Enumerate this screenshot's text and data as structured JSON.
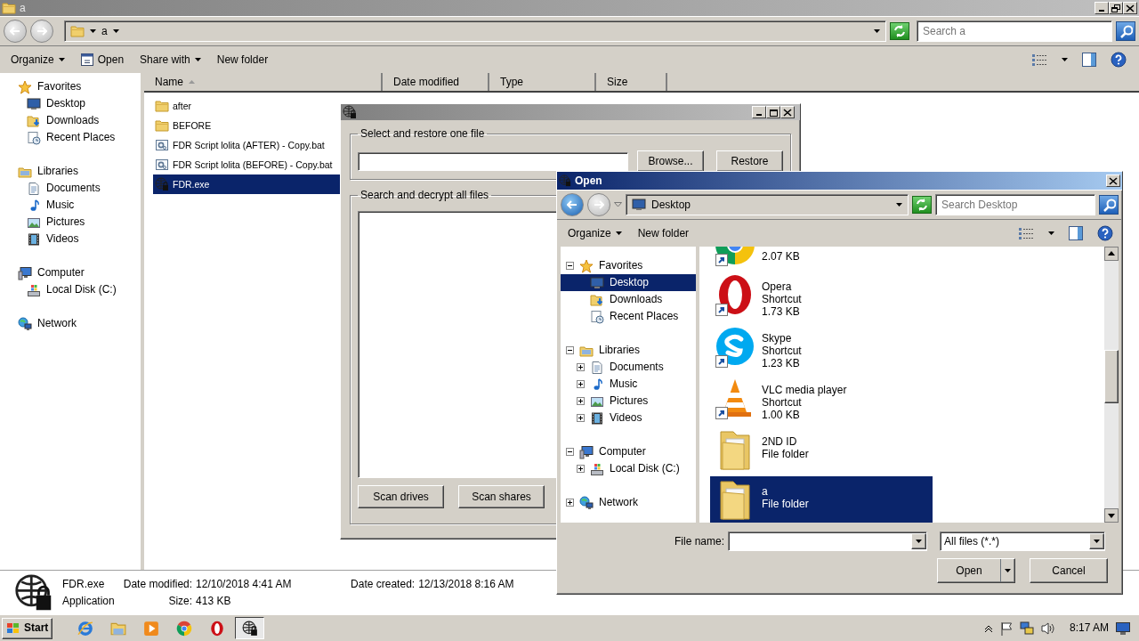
{
  "explorer": {
    "title": "a",
    "path": [
      "a"
    ],
    "search": {
      "placeholder": "Search a"
    },
    "toolbar": [
      {
        "label": "Organize",
        "kind": "menu"
      },
      {
        "label": "Open",
        "kind": "command"
      },
      {
        "label": "Share with",
        "kind": "menu"
      },
      {
        "label": "New folder",
        "kind": "plain"
      }
    ],
    "nav": [
      {
        "label": "Favorites",
        "kind": "favorites",
        "children": [
          {
            "label": "Desktop",
            "kind": "desktop"
          },
          {
            "label": "Downloads",
            "kind": "downloads"
          },
          {
            "label": "Recent Places",
            "kind": "recent"
          }
        ]
      },
      {
        "label": "Libraries",
        "kind": "libraries",
        "children": [
          {
            "label": "Documents",
            "kind": "documents"
          },
          {
            "label": "Music",
            "kind": "music"
          },
          {
            "label": "Pictures",
            "kind": "pictures"
          },
          {
            "label": "Videos",
            "kind": "videos"
          }
        ]
      },
      {
        "label": "Computer",
        "kind": "computer",
        "children": [
          {
            "label": "Local Disk (C:)",
            "kind": "disk"
          }
        ]
      },
      {
        "label": "Network",
        "kind": "network"
      }
    ],
    "columns": [
      {
        "label": "Name",
        "sorted": true
      },
      {
        "label": "Date modified",
        "sorted": false
      },
      {
        "label": "Type",
        "sorted": false
      },
      {
        "label": "Size",
        "sorted": false
      }
    ],
    "files": [
      {
        "name": "after",
        "kind": "folder",
        "selected": false
      },
      {
        "name": "BEFORE",
        "kind": "folder",
        "selected": false
      },
      {
        "name": "FDR Script lolita (AFTER) - Copy.bat",
        "kind": "script",
        "selected": false
      },
      {
        "name": "FDR Script lolita (BEFORE) - Copy.bat",
        "kind": "script",
        "selected": false
      },
      {
        "name": "FDR.exe",
        "kind": "app",
        "selected": true
      }
    ],
    "details": {
      "name": "FDR.exe",
      "type": "Application",
      "fields": [
        {
          "label": "Date modified:",
          "value": "12/10/2018 4:41 AM"
        },
        {
          "label": "Date created:",
          "value": "12/13/2018 8:16 AM"
        },
        {
          "label": "Size:",
          "value": "413 KB"
        }
      ]
    }
  },
  "fdr_window": {
    "restore_group": {
      "title": "Select and restore one file",
      "buttons": [
        "Browse...",
        "Restore"
      ]
    },
    "decrypt_group": {
      "title": "Search and decrypt all files",
      "buttons": [
        "Scan drives",
        "Scan shares"
      ]
    }
  },
  "open_dialog": {
    "title": "Open",
    "location": "Desktop",
    "search": {
      "placeholder": "Search Desktop"
    },
    "toolbar": [
      {
        "label": "Organize",
        "kind": "menu"
      },
      {
        "label": "New folder",
        "kind": "plain"
      }
    ],
    "tree": [
      {
        "label": "Favorites",
        "kind": "favorites",
        "expanded": true,
        "selected": false,
        "children": [
          {
            "label": "Desktop",
            "kind": "desktop",
            "selected": true
          },
          {
            "label": "Downloads",
            "kind": "downloads",
            "selected": false
          },
          {
            "label": "Recent Places",
            "kind": "recent",
            "selected": false
          }
        ]
      },
      {
        "label": "Libraries",
        "kind": "libraries",
        "expanded": true,
        "selected": false,
        "children": [
          {
            "label": "Documents",
            "kind": "documents",
            "expanded": false,
            "selected": false
          },
          {
            "label": "Music",
            "kind": "music",
            "expanded": false,
            "selected": false
          },
          {
            "label": "Pictures",
            "kind": "pictures",
            "expanded": false,
            "selected": false
          },
          {
            "label": "Videos",
            "kind": "videos",
            "expanded": false,
            "selected": false
          }
        ]
      },
      {
        "label": "Computer",
        "kind": "computer",
        "expanded": true,
        "selected": false,
        "children": [
          {
            "label": "Local Disk (C:)",
            "kind": "disk",
            "expanded": false,
            "selected": false
          }
        ]
      },
      {
        "label": "Network",
        "kind": "network",
        "expanded": false,
        "selected": false
      }
    ],
    "items": [
      {
        "kind": "pinwheel",
        "lines": [
          "2.07 KB"
        ],
        "shortcut": true,
        "selected": false
      },
      {
        "kind": "ring",
        "lines": [
          "Opera",
          "Shortcut",
          "1.73 KB"
        ],
        "shortcut": true,
        "selected": false
      },
      {
        "kind": "swirl",
        "lines": [
          "Skype",
          "Shortcut",
          "1.23 KB"
        ],
        "shortcut": true,
        "selected": false
      },
      {
        "kind": "cone",
        "lines": [
          "VLC media player",
          "Shortcut",
          "1.00 KB"
        ],
        "shortcut": true,
        "selected": false
      },
      {
        "kind": "folder",
        "lines": [
          "2ND ID",
          "File folder"
        ],
        "shortcut": false,
        "selected": false
      },
      {
        "kind": "folder",
        "lines": [
          "a",
          "File folder"
        ],
        "shortcut": false,
        "selected": true
      }
    ],
    "file_name_label": "File name:",
    "filter": "All files (*.*)",
    "buttons": [
      "Open",
      "Cancel"
    ]
  },
  "taskbar": {
    "start": "Start",
    "apps": [
      {
        "kind": "ie",
        "active": false
      },
      {
        "kind": "explorer",
        "active": false
      },
      {
        "kind": "media",
        "active": false
      },
      {
        "kind": "chrome",
        "active": false
      },
      {
        "kind": "opera",
        "active": false
      },
      {
        "kind": "app",
        "active": true
      }
    ],
    "clock": "8:17 AM"
  }
}
